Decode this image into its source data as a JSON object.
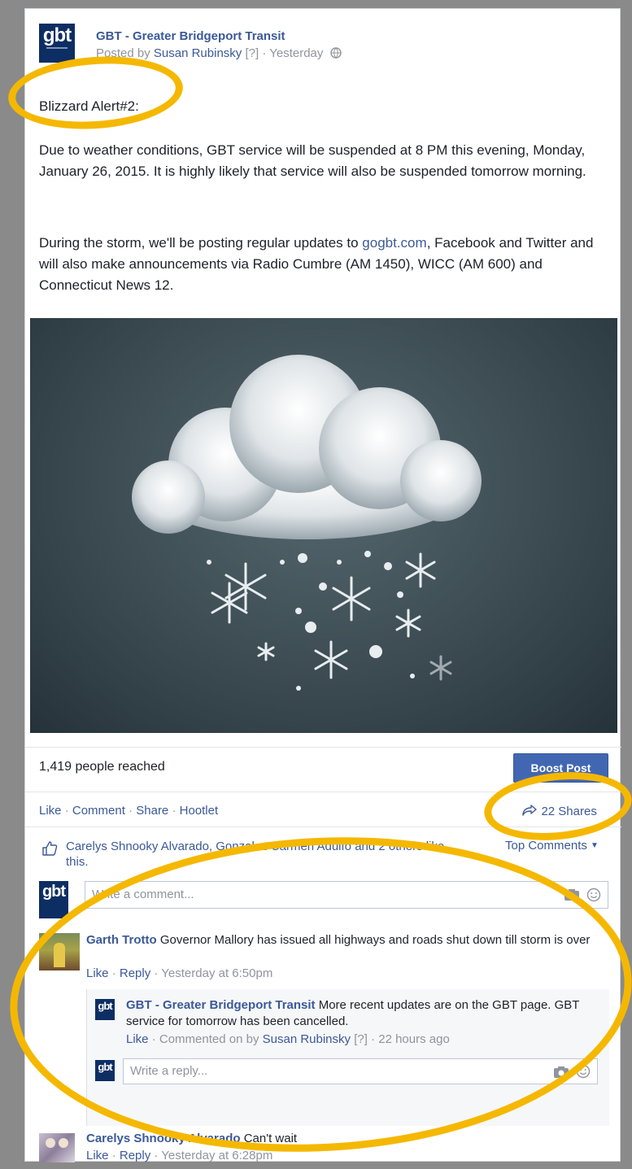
{
  "post": {
    "page_name": "GBT - Greater Bridgeport Transit",
    "posted_by_prefix": "Posted by",
    "posted_by_name": "Susan Rubinsky",
    "posted_by_tag": "[?]",
    "separator": "·",
    "time": "Yesterday",
    "logo_text": "gbt",
    "heading": "Blizzard Alert#2:",
    "paragraph1": "Due to weather conditions, GBT service will be suspended at 8 PM this evening, Monday, January 26, 2015. It is highly likely that service will also be suspended tomorrow morning.",
    "paragraph2_before_link": "During the storm, we'll be posting regular updates to ",
    "paragraph2_link": "gogbt.com",
    "paragraph2_after_link": ", Facebook and Twitter and will also make announcements via Radio Cumbre (AM 1450), WICC (AM 600) and Connecticut News 12."
  },
  "stats": {
    "reached": "1,419 people reached",
    "boost_button": "Boost Post",
    "shares": "22 Shares"
  },
  "actions": {
    "like": "Like",
    "comment": "Comment",
    "share": "Share",
    "hootlet": "Hootlet",
    "sep": " · "
  },
  "likes": {
    "text": "Carelys Shnooky Alvarado, Gonzalez Carmen Adulfo and 2 others like this.",
    "top_comments": "Top Comments"
  },
  "composer": {
    "placeholder": "Write a comment...",
    "reply_placeholder": "Write a reply..."
  },
  "comments": [
    {
      "author": "Garth Trotto",
      "text": "Governor Mallory has issued all highways and roads shut down till storm is over",
      "like": "Like",
      "reply": "Reply",
      "time": "Yesterday at 6:50pm"
    },
    {
      "author": "Carelys Shnooky Alvarado",
      "text": "Can't wait",
      "like": "Like",
      "reply": "Reply",
      "time": "Yesterday at 6:28pm"
    }
  ],
  "reply": {
    "author": "GBT - Greater Bridgeport Transit",
    "text": "More recent updates are on the GBT page. GBT service for tomorrow has been cancelled.",
    "like": "Like",
    "commented_on_by": "Commented on by",
    "commenter": "Susan Rubinsky",
    "tag": "[?]",
    "time": "22 hours ago"
  },
  "colors": {
    "highlight": "#f5b800",
    "brand": "#0d2e63",
    "link": "#3b5998"
  }
}
